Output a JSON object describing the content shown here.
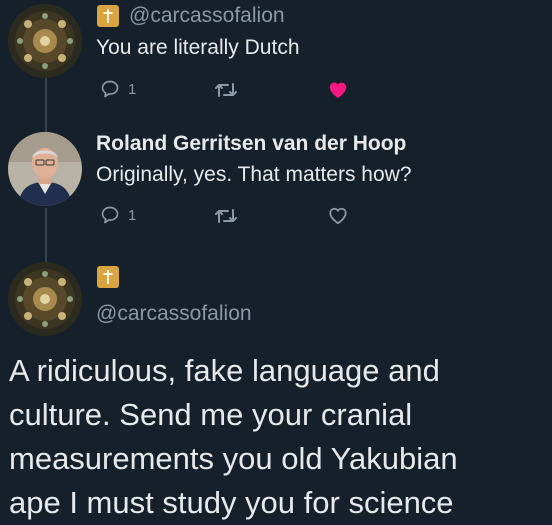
{
  "colors": {
    "background": "#15202b",
    "text": "#e7e9ea",
    "secondary_text": "#8b98a5",
    "like_active": "#f91880",
    "badge": "#d9a441"
  },
  "tweet1": {
    "handle": "@carcassofalion",
    "text": "You are literally Dutch",
    "reply_count": "1",
    "liked": true
  },
  "tweet2": {
    "name": "Roland Gerritsen van der Hoop",
    "text": "Originally, yes. That matters how?",
    "reply_count": "1",
    "liked": false
  },
  "tweet3": {
    "handle": "@carcassofalion",
    "text_lines": [
      "A ridiculous, fake language and",
      "culture. Send me your cranial",
      "measurements you old Yakubian",
      "ape I must study you for science"
    ]
  },
  "icons": {
    "reply": "reply-icon",
    "retweet": "retweet-icon",
    "like": "heart-icon",
    "badge": "cross-badge-icon"
  }
}
